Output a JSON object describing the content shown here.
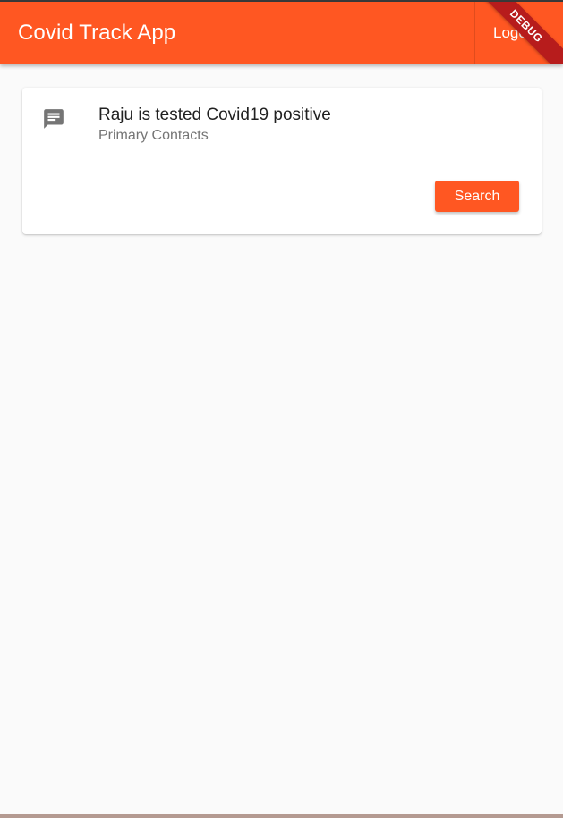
{
  "app_bar": {
    "title": "Covid Track App",
    "logout_label": "Logout",
    "debug_label": "DEBUG",
    "background_color": "#ff5722"
  },
  "card": {
    "icon": "message-icon",
    "title": "Raju is tested Covid19 positive",
    "subtitle": "Primary Contacts",
    "search_label": "Search",
    "button_color": "#ff5722"
  }
}
